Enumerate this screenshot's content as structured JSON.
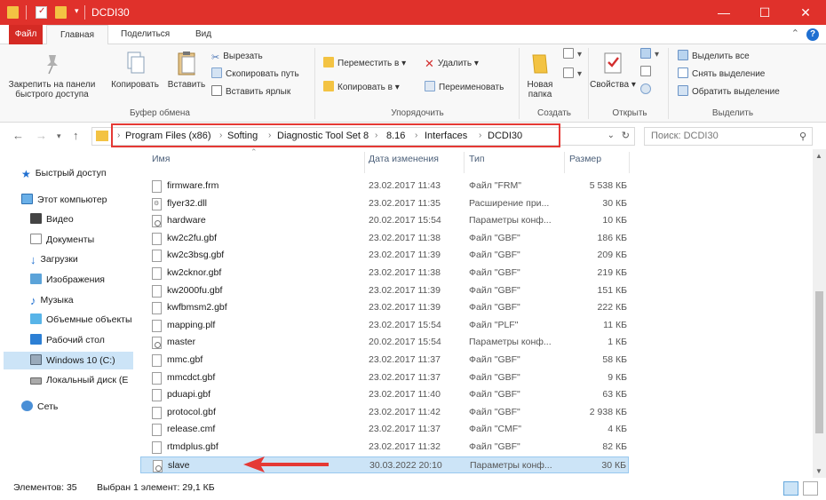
{
  "window": {
    "title": "DCDI30",
    "min_glyph": "—",
    "max_glyph": "☐",
    "close_glyph": "✕",
    "accent": "#e0312b"
  },
  "tabs": {
    "file": "Файл",
    "home": "Главная",
    "share": "Поделиться",
    "view": "Вид"
  },
  "ribbon": {
    "clipboard": {
      "pin": "Закрепить на панели быстрого доступа",
      "copy": "Копировать",
      "paste": "Вставить",
      "cut": "Вырезать",
      "copy_path": "Скопировать путь",
      "paste_shortcut": "Вставить ярлык",
      "label": "Буфер обмена"
    },
    "organize": {
      "move_to": "Переместить в",
      "copy_to": "Копировать в",
      "delete": "Удалить",
      "rename": "Переименовать",
      "label": "Упорядочить"
    },
    "new": {
      "new_folder": "Новая папка",
      "label": "Создать"
    },
    "open": {
      "properties": "Свойства",
      "label": "Открыть"
    },
    "select": {
      "select_all": "Выделить все",
      "select_none": "Снять выделение",
      "invert": "Обратить выделение",
      "label": "Выделить"
    }
  },
  "address": {
    "crumbs": [
      "Program Files (x86)",
      "Softing",
      "Diagnostic Tool Set 8",
      "8.16",
      "Interfaces",
      "DCDI30"
    ],
    "search_placeholder": "Поиск: DCDI30"
  },
  "nav": {
    "items": [
      {
        "label": "Быстрый доступ",
        "icon": "star-icon"
      },
      {
        "label": "Этот компьютер",
        "icon": "computer-icon"
      },
      {
        "label": "Видео",
        "icon": "video-icon"
      },
      {
        "label": "Документы",
        "icon": "documents-icon"
      },
      {
        "label": "Загрузки",
        "icon": "downloads-icon"
      },
      {
        "label": "Изображения",
        "icon": "pictures-icon"
      },
      {
        "label": "Музыка",
        "icon": "music-icon"
      },
      {
        "label": "Объемные объекты",
        "icon": "3d-objects-icon"
      },
      {
        "label": "Рабочий стол",
        "icon": "desktop-icon"
      },
      {
        "label": "Windows 10 (C:)",
        "icon": "drive-icon"
      },
      {
        "label": "Локальный диск (E",
        "icon": "drive-icon"
      },
      {
        "label": "Сеть",
        "icon": "network-icon"
      }
    ]
  },
  "columns": {
    "name": "Имя",
    "date": "Дата изменения",
    "type": "Тип",
    "size": "Размер"
  },
  "files": [
    {
      "name": "firmware.frm",
      "date": "23.02.2017 11:43",
      "type": "Файл \"FRM\"",
      "size": "5 538 КБ",
      "icon": "file"
    },
    {
      "name": "flyer32.dll",
      "date": "23.02.2017 11:35",
      "type": "Расширение при...",
      "size": "30 КБ",
      "icon": "dll"
    },
    {
      "name": "hardware",
      "date": "20.02.2017 15:54",
      "type": "Параметры конф...",
      "size": "10 КБ",
      "icon": "cfg"
    },
    {
      "name": "kw2c2fu.gbf",
      "date": "23.02.2017 11:38",
      "type": "Файл \"GBF\"",
      "size": "186 КБ",
      "icon": "file"
    },
    {
      "name": "kw2c3bsg.gbf",
      "date": "23.02.2017 11:39",
      "type": "Файл \"GBF\"",
      "size": "209 КБ",
      "icon": "file"
    },
    {
      "name": "kw2cknor.gbf",
      "date": "23.02.2017 11:38",
      "type": "Файл \"GBF\"",
      "size": "219 КБ",
      "icon": "file"
    },
    {
      "name": "kw2000fu.gbf",
      "date": "23.02.2017 11:39",
      "type": "Файл \"GBF\"",
      "size": "151 КБ",
      "icon": "file"
    },
    {
      "name": "kwfbmsm2.gbf",
      "date": "23.02.2017 11:39",
      "type": "Файл \"GBF\"",
      "size": "222 КБ",
      "icon": "file"
    },
    {
      "name": "mapping.plf",
      "date": "23.02.2017 15:54",
      "type": "Файл \"PLF\"",
      "size": "11 КБ",
      "icon": "file"
    },
    {
      "name": "master",
      "date": "20.02.2017 15:54",
      "type": "Параметры конф...",
      "size": "1 КБ",
      "icon": "cfg"
    },
    {
      "name": "mmc.gbf",
      "date": "23.02.2017 11:37",
      "type": "Файл \"GBF\"",
      "size": "58 КБ",
      "icon": "file"
    },
    {
      "name": "mmcdct.gbf",
      "date": "23.02.2017 11:37",
      "type": "Файл \"GBF\"",
      "size": "9 КБ",
      "icon": "file"
    },
    {
      "name": "pduapi.gbf",
      "date": "23.02.2017 11:40",
      "type": "Файл \"GBF\"",
      "size": "63 КБ",
      "icon": "file"
    },
    {
      "name": "protocol.gbf",
      "date": "23.02.2017 11:42",
      "type": "Файл \"GBF\"",
      "size": "2 938 КБ",
      "icon": "file"
    },
    {
      "name": "release.cmf",
      "date": "23.02.2017 11:37",
      "type": "Файл \"CMF\"",
      "size": "4 КБ",
      "icon": "file"
    },
    {
      "name": "rtmdplus.gbf",
      "date": "23.02.2017 11:32",
      "type": "Файл \"GBF\"",
      "size": "82 КБ",
      "icon": "file"
    },
    {
      "name": "slave",
      "date": "30.03.2022 20:10",
      "type": "Параметры конф...",
      "size": "30 КБ",
      "icon": "cfg",
      "selected": true
    }
  ],
  "status": {
    "count": "Элементов: 35",
    "selected": "Выбран 1 элемент: 29,1 КБ"
  }
}
